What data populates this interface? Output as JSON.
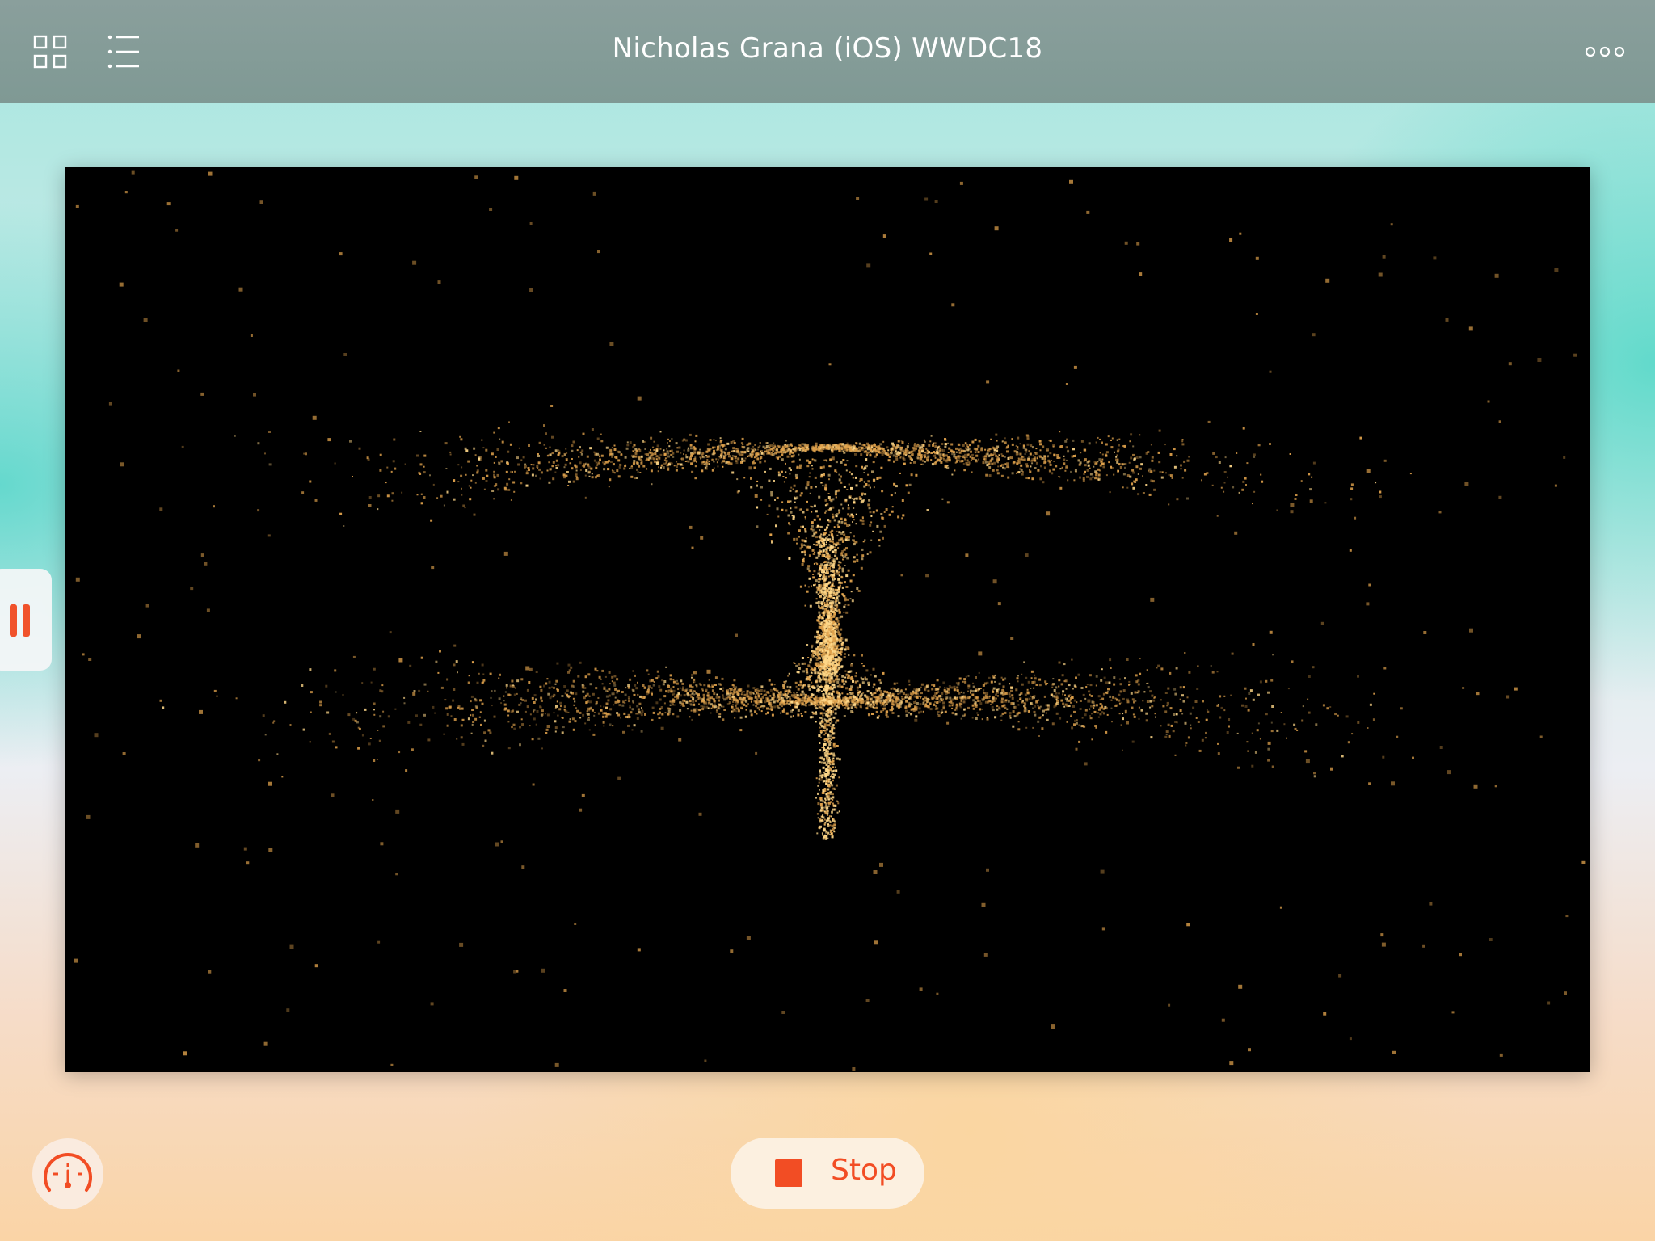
{
  "nav": {
    "title": "Nicholas Grana (iOS) WWDC18",
    "left_icons": [
      "grid-icon",
      "list-icon"
    ],
    "right_icon": "more-icon"
  },
  "controls": {
    "pause_icon": "pause-icon",
    "gauge_icon": "speedometer-icon",
    "stop_label": "Stop",
    "stop_icon": "stop-icon"
  },
  "colors": {
    "accent": "#f24d24",
    "nav_bar": "#829b97",
    "particle": "#e0a24c",
    "particle_bright": "#ffd889",
    "stage_background": "#000000"
  }
}
